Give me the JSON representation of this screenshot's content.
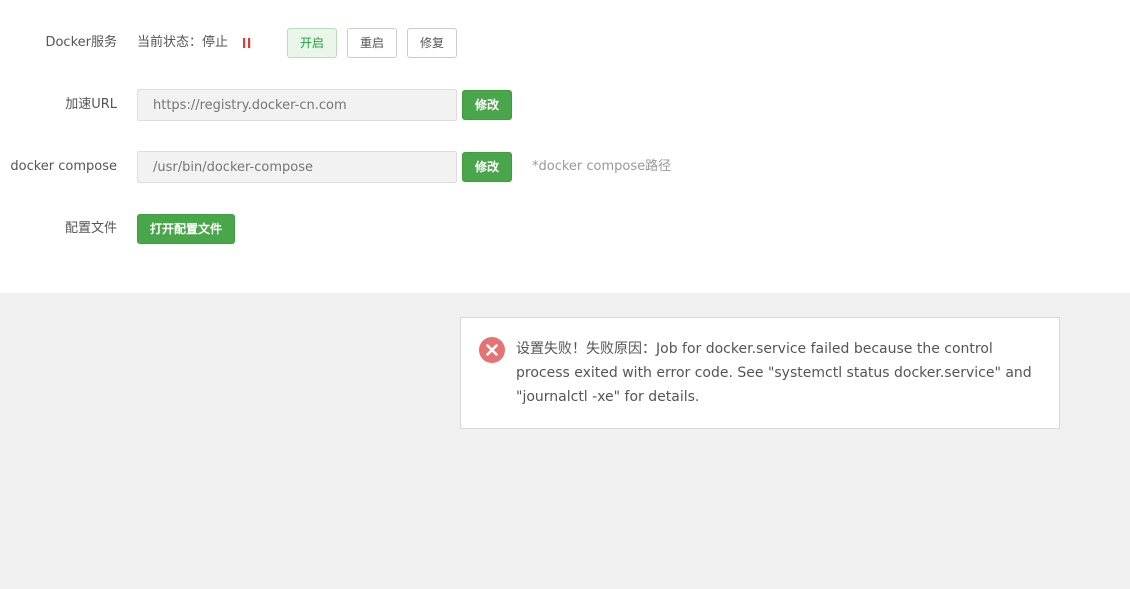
{
  "docker_service": {
    "label": "Docker服务",
    "status_text": "当前状态：停止",
    "status_icon": "pause-icon",
    "status_color": "#e53935",
    "buttons": {
      "start": "开启",
      "restart": "重启",
      "repair": "修复"
    }
  },
  "accelerate_url": {
    "label": "加速URL",
    "placeholder": "https://registry.docker-cn.com",
    "button": "修改"
  },
  "docker_compose": {
    "label": "docker compose",
    "placeholder": "/usr/bin/docker-compose",
    "button": "修改",
    "hint": "*docker compose路径"
  },
  "config_file": {
    "label": "配置文件",
    "button": "打开配置文件"
  },
  "error_toast": {
    "icon": "error-icon",
    "icon_color": "#e57373",
    "message": "设置失败！失败原因：Job for docker.service failed because the control process exited with error code. See \"systemctl status docker.service\" and \"journalctl -xe\" for details."
  },
  "colors": {
    "accent_green": "#4aa64a",
    "active_text": "#20a53a"
  }
}
